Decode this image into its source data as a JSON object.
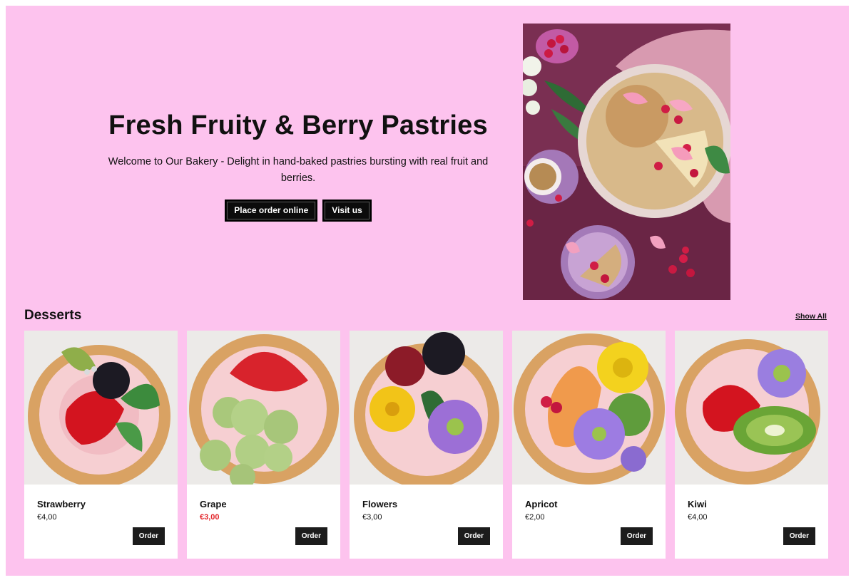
{
  "hero": {
    "title": "Fresh Fruity & Berry Pastries",
    "subtitle": "Welcome to Our Bakery - Delight in hand-baked pastries bursting with real fruit and berries.",
    "order_online_label": "Place order online",
    "visit_label": "Visit us"
  },
  "desserts": {
    "title": "Desserts",
    "show_all_label": "Show All",
    "order_label": "Order",
    "items": [
      {
        "name": "Strawberry",
        "price": "€4,00",
        "sale": false
      },
      {
        "name": "Grape",
        "price": "€3,00",
        "sale": true
      },
      {
        "name": "Flowers",
        "price": "€3,00",
        "sale": false
      },
      {
        "name": "Apricot",
        "price": "€2,00",
        "sale": false
      },
      {
        "name": "Kiwi",
        "price": "€4,00",
        "sale": false
      }
    ]
  },
  "colors": {
    "page_background": "#fdc3ee",
    "button_background": "#0b0b0b",
    "sale_price": "#e3262b"
  }
}
